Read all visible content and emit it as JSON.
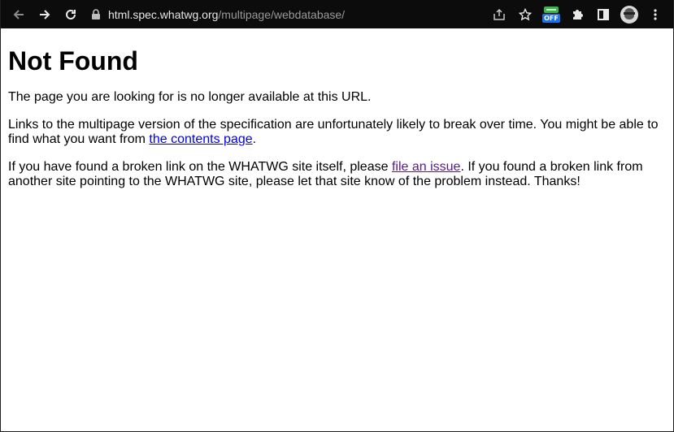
{
  "browser": {
    "url_host": "html.spec.whatwg.org",
    "url_path": "/multipage/webdatabase/",
    "icons": {
      "back": "arrow-left-icon",
      "forward": "arrow-right-icon",
      "reload": "reload-icon",
      "lock": "lock-icon",
      "share": "share-icon",
      "bookmark": "star-icon",
      "extension_off": "extension-off-icon",
      "extensions": "puzzle-icon",
      "side_panel": "side-panel-icon",
      "profile": "avatar",
      "menu": "kebab-menu-icon"
    },
    "extension_badge": "OFF"
  },
  "page": {
    "title": "Not Found",
    "para1": "The page you are looking for is no longer available at this URL.",
    "para2_before": "Links to the multipage version of the specification are unfortunately likely to break over time. You might be able to find what you want from ",
    "para2_link": "the contents page",
    "para2_after": ".",
    "para3_before": "If you have found a broken link on the WHATWG site itself, please ",
    "para3_link": "file an issue",
    "para3_after": ". If you found a broken link from another site pointing to the WHATWG site, please let that site know of the problem instead. Thanks!"
  },
  "colors": {
    "toolbar_bg": "#0c0c0c",
    "link": "#0000ee",
    "visited_link": "#551a8b"
  }
}
